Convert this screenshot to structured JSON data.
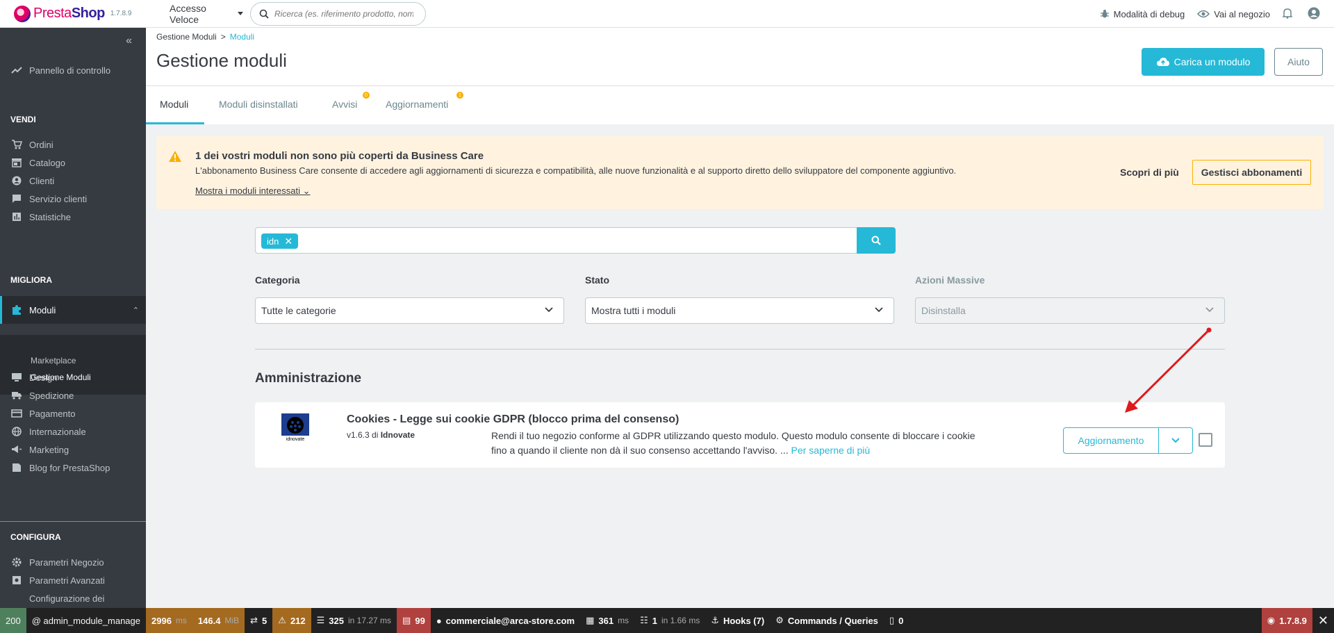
{
  "topbar": {
    "logo_text_a": "Presta",
    "logo_text_b": "Shop",
    "version": "1.7.8.9",
    "quick_access": "Accesso Veloce",
    "search_placeholder": "Ricerca (es. riferimento prodotto, nom",
    "debug_mode": "Modalità di debug",
    "go_to_shop": "Vai al negozio"
  },
  "sidebar": {
    "dashboard": "Pannello di controllo",
    "sections": {
      "sell": "VENDI",
      "improve": "MIGLIORA",
      "configure": "CONFIGURA"
    },
    "sell_items": [
      "Ordini",
      "Catalogo",
      "Clienti",
      "Servizio clienti",
      "Statistiche"
    ],
    "modules": "Moduli",
    "modules_sub": [
      "Marketplace",
      "Gestione Moduli"
    ],
    "improve_items": [
      "Design",
      "Spedizione",
      "Pagamento",
      "Internazionale",
      "Marketing",
      "Blog for PrestaShop"
    ],
    "configure_items": [
      "Parametri Negozio",
      "Parametri Avanzati",
      "Configurazione dei"
    ]
  },
  "header": {
    "breadcrumb_parent": "Gestione Moduli",
    "breadcrumb_current": "Moduli",
    "title": "Gestione moduli",
    "upload_button": "Carica un modulo",
    "help_button": "Aiuto",
    "tabs": [
      {
        "label": "Moduli"
      },
      {
        "label": "Moduli disinstallati"
      },
      {
        "label": "Avvisi",
        "badge": "0"
      },
      {
        "label": "Aggiornamenti",
        "badge": "1"
      }
    ]
  },
  "alert": {
    "title": "1 dei vostri moduli non sono più coperti da Business Care",
    "text": "L'abbonamento Business Care consente di accedere agli aggiornamenti di sicurezza e compatibilità, alle nuove funzionalità e al supporto diretto dello sviluppatore del componente aggiuntivo.",
    "link": "Mostra i moduli interessati",
    "learn_more": "Scopri di più",
    "manage_button": "Gestisci abbonamenti"
  },
  "search": {
    "tag": "idn"
  },
  "filters": {
    "category_label": "Categoria",
    "category_value": "Tutte le categorie",
    "status_label": "Stato",
    "status_value": "Mostra tutti i moduli",
    "bulk_label": "Azioni Massive",
    "bulk_value": "Disinstalla"
  },
  "section": {
    "title": "Amministrazione"
  },
  "module": {
    "name": "Cookies - Legge sui cookie GDPR (blocco prima del consenso)",
    "version_prefix": "v1.6.3 di ",
    "author": "Idnovate",
    "description": "Rendi il tuo negozio conforme al GDPR utilizzando questo modulo. Questo modulo consente di bloccare i cookie fino a quando il cliente non dà il suo consenso accettando l'avviso. ...",
    "read_more": "Per saperne di più",
    "logo_text": "idnovate",
    "action_button": "Aggiornamento"
  },
  "debugbar": {
    "status": "200",
    "route": "@ admin_module_manage",
    "time": "2996",
    "time_unit": "ms",
    "memory": "146.4",
    "memory_unit": "MiB",
    "forms": "5",
    "logs": "212",
    "cache_calls": "325",
    "cache_time": "in 17.27 ms",
    "translations": "99",
    "user": "commerciale@arca-store.com",
    "twig_time": "361",
    "twig_unit": "ms",
    "db_queries": "1",
    "db_time": "in 1.66 ms",
    "hooks": "Hooks (7)",
    "commands": "Commands / Queries",
    "messenger": "0",
    "sf_version": "1.7.8.9"
  },
  "colors": {
    "accent": "#25b9d7",
    "sidebar_bg": "#363a41",
    "warning": "#fab000",
    "alert_bg": "#fff3e0"
  }
}
